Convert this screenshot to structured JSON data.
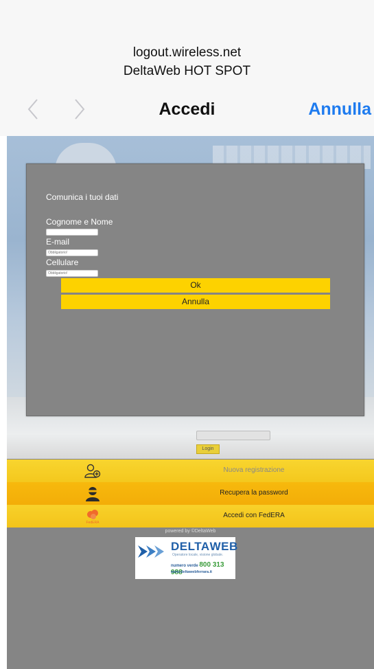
{
  "browser": {
    "host": "logout.wireless.net",
    "site_name": "DeltaWeb HOT SPOT",
    "title": "Accedi",
    "cancel_label": "Annulla",
    "back_icon": "chevron-left-icon",
    "forward_icon": "chevron-right-icon",
    "accent_color": "#1e7bef"
  },
  "dialog": {
    "heading": "Comunica i tuoi dati",
    "fields": [
      {
        "label": "Cognome e Nome",
        "placeholder": ""
      },
      {
        "label": "E-mail",
        "placeholder": "Obbligatorio!"
      },
      {
        "label": "Cellulare",
        "placeholder": "Obbligatorio!"
      }
    ],
    "ok_label": "Ok",
    "cancel_label": "Annulla",
    "button_color": "#fdd200"
  },
  "login": {
    "button_label": "Login"
  },
  "menu": [
    {
      "icon": "add-user-icon",
      "label": "Nuova registrazione"
    },
    {
      "icon": "masked-user-icon",
      "label": "Recupera la password"
    },
    {
      "icon": "federa-logo-icon",
      "icon_text": "FedERA",
      "label": "Accedi con FedERA"
    }
  ],
  "footer": {
    "powered_by": "powered by ©DeltaWeb",
    "logo": {
      "brand_prefix": "DELTA",
      "brand_suffix": "WEB",
      "slogan": "Operatore locale, visione globale.",
      "phone_label": "numero verde",
      "phone_number": "800 313 988",
      "website": "www.deltawebferrara.it"
    }
  }
}
